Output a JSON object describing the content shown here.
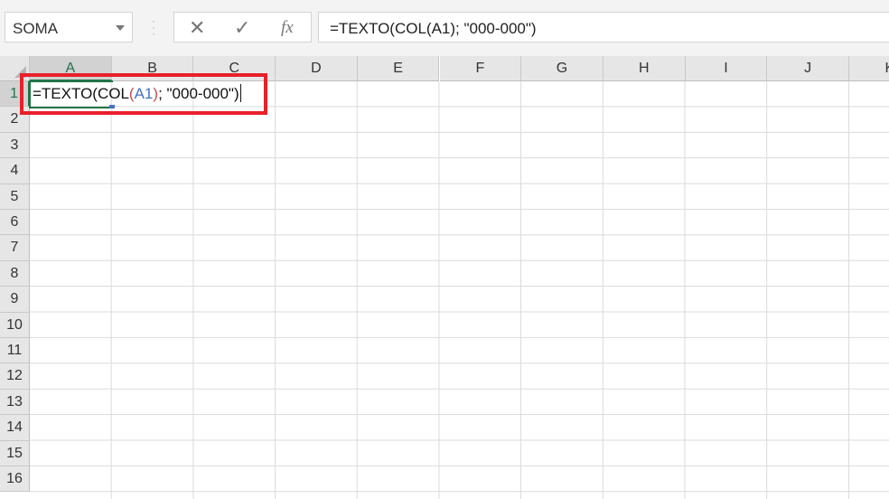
{
  "name_box": {
    "value": "SOMA"
  },
  "formula_buttons": {
    "cancel": "✕",
    "enter": "✓",
    "fx": "fx"
  },
  "formula_bar": {
    "value": "=TEXTO(COL(A1); \"000-000\")"
  },
  "cell_edit": {
    "part1": "=TEXTO(",
    "part2": "COL",
    "part3": "(",
    "ref": "A1",
    "part4": ")",
    "part5": "; \"000-000\")"
  },
  "columns": [
    "A",
    "B",
    "C",
    "D",
    "E",
    "F",
    "G",
    "H",
    "I",
    "J",
    "K"
  ],
  "rows": [
    "1",
    "2",
    "3",
    "4",
    "5",
    "6",
    "7",
    "8",
    "9",
    "10",
    "11",
    "12",
    "13",
    "14",
    "15",
    "16"
  ]
}
